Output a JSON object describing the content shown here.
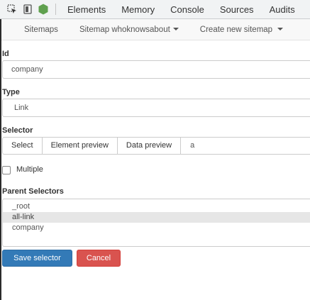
{
  "devtools": {
    "tabs": [
      "Elements",
      "Memory",
      "Console",
      "Sources",
      "Audits"
    ]
  },
  "nav": {
    "sitemaps": "Sitemaps",
    "sitemap_dropdown": "Sitemap whoknowsabout",
    "create_new": "Create new sitemap"
  },
  "form": {
    "id_label": "Id",
    "id_value": "company",
    "type_label": "Type",
    "type_value": "Link",
    "selector_label": "Selector",
    "select_btn": "Select",
    "element_preview_btn": "Element preview",
    "data_preview_btn": "Data preview",
    "selector_value": "a",
    "multiple_label": "Multiple",
    "multiple_checked": false,
    "parent_label": "Parent Selectors",
    "parents": [
      "_root",
      "all-link",
      "company"
    ],
    "parents_selected": "all-link",
    "save_btn": "Save selector",
    "cancel_btn": "Cancel"
  },
  "colors": {
    "save": "#337ab7",
    "cancel": "#d9534f",
    "node_icon": "#5fa04e"
  }
}
